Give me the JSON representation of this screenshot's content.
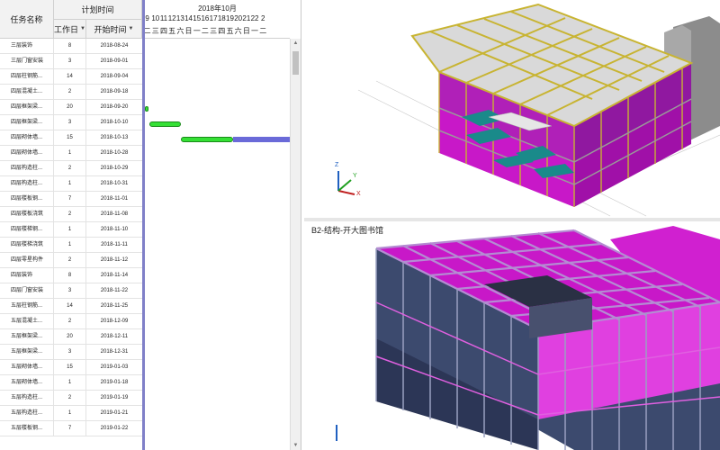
{
  "gantt": {
    "header": {
      "task_name": "任务名称",
      "plan_time": "计划时间",
      "work_days": "工作日",
      "start_date": "开始时间",
      "month": "2018年10月",
      "day_numbers": [
        "9",
        "10",
        "11",
        "12",
        "13",
        "14",
        "15",
        "16",
        "17",
        "18",
        "19",
        "20",
        "21",
        "22",
        "2"
      ],
      "weekdays": [
        "二",
        "三",
        "四",
        "五",
        "六",
        "日",
        "一",
        "二",
        "三",
        "四",
        "五",
        "六",
        "日",
        "一",
        "二"
      ]
    },
    "rows": [
      {
        "name": "三层装饰",
        "days": "8",
        "start": "2018-08-24"
      },
      {
        "name": "三层门窗安装",
        "days": "3",
        "start": "2018-09-01"
      },
      {
        "name": "四层柱钢筋...",
        "days": "14",
        "start": "2018-09-04"
      },
      {
        "name": "四层混凝土...",
        "days": "2",
        "start": "2018-09-18"
      },
      {
        "name": "四层框架梁...",
        "days": "20",
        "start": "2018-09-20"
      },
      {
        "name": "四层框架梁...",
        "days": "3",
        "start": "2018-10-10"
      },
      {
        "name": "四层砌体墙...",
        "days": "15",
        "start": "2018-10-13"
      },
      {
        "name": "四层砌体墙...",
        "days": "1",
        "start": "2018-10-28"
      },
      {
        "name": "四层构造柱...",
        "days": "2",
        "start": "2018-10-29"
      },
      {
        "name": "四层构造柱...",
        "days": "1",
        "start": "2018-10-31"
      },
      {
        "name": "四层楼板钢...",
        "days": "7",
        "start": "2018-11-01"
      },
      {
        "name": "四层楼板浇筑",
        "days": "2",
        "start": "2018-11-08"
      },
      {
        "name": "四层楼梯钢...",
        "days": "1",
        "start": "2018-11-10"
      },
      {
        "name": "四层楼梯浇筑",
        "days": "1",
        "start": "2018-11-11"
      },
      {
        "name": "四层零星构件",
        "days": "2",
        "start": "2018-11-12"
      },
      {
        "name": "四层装饰",
        "days": "8",
        "start": "2018-11-14"
      },
      {
        "name": "四层门窗安装",
        "days": "3",
        "start": "2018-11-22"
      },
      {
        "name": "五层柱钢筋...",
        "days": "14",
        "start": "2018-11-25"
      },
      {
        "name": "五层混凝土...",
        "days": "2",
        "start": "2018-12-09"
      },
      {
        "name": "五层框架梁...",
        "days": "20",
        "start": "2018-12-11"
      },
      {
        "name": "五层框架梁...",
        "days": "3",
        "start": "2018-12-31"
      },
      {
        "name": "五层砌体墙...",
        "days": "15",
        "start": "2019-01-03"
      },
      {
        "name": "五层砌体墙...",
        "days": "1",
        "start": "2019-01-18"
      },
      {
        "name": "五层构造柱...",
        "days": "2",
        "start": "2019-01-19"
      },
      {
        "name": "五层构造柱...",
        "days": "1",
        "start": "2019-01-21"
      },
      {
        "name": "五层楼板钢...",
        "days": "7",
        "start": "2019-01-22"
      }
    ]
  },
  "viewport_bottom": {
    "title": "B2-结构-开大图书馆"
  },
  "axes": {
    "x": "X",
    "y": "Y",
    "z": "Z"
  },
  "colors": {
    "bar_green": "#35e035",
    "bar_purple": "#6a6ad8",
    "model_magenta": "#d020d0",
    "model_yellow": "#c8b432",
    "model_teal": "#1a8a8a"
  }
}
